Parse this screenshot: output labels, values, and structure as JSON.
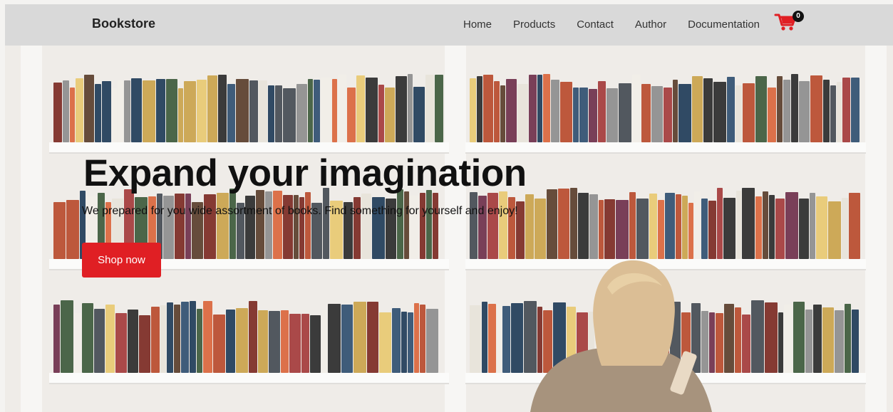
{
  "header": {
    "brand": "Bookstore",
    "nav": [
      "Home",
      "Products",
      "Contact",
      "Author",
      "Documentation"
    ],
    "cart_count": "0",
    "cart_icon": "cart-icon"
  },
  "hero": {
    "title": "Expand your imagination",
    "subtitle": "We prepared for you wide assortment of books. Find something for yourself and enjoy!",
    "button_label": "Shop now"
  },
  "colors": {
    "accent": "#e01f24",
    "navbar_bg": "#d9d9d9"
  }
}
